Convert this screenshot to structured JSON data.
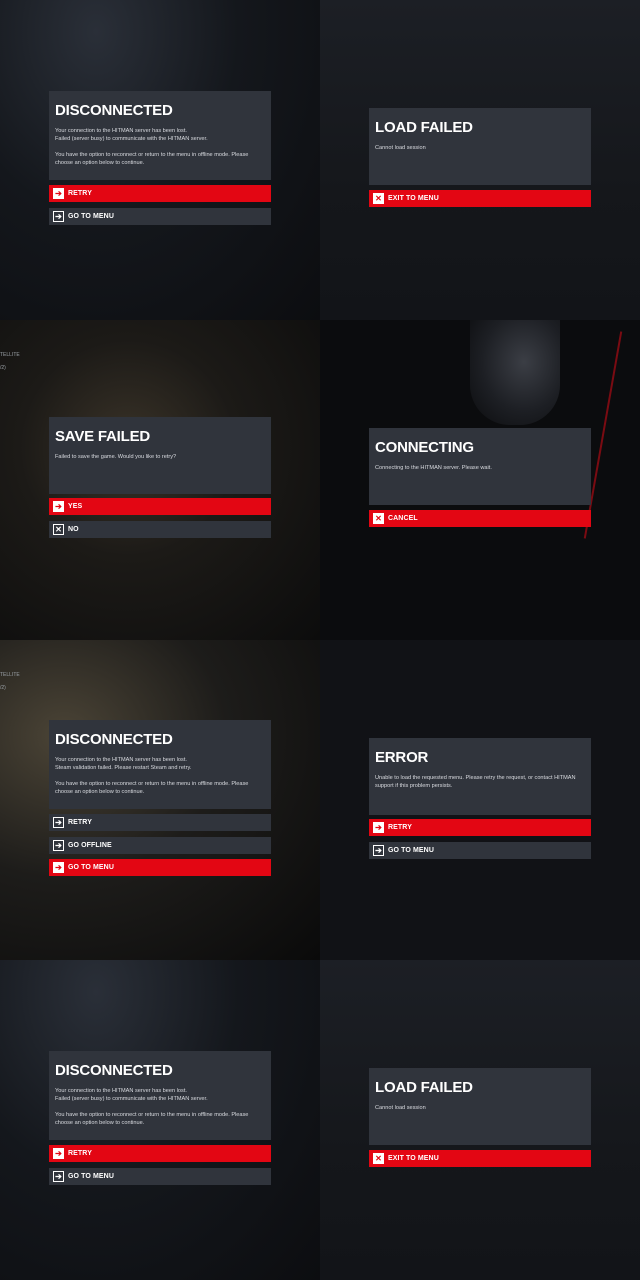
{
  "screens": [
    {
      "title": "DISCONNECTED",
      "body": "Your connection to the HITMAN server has been lost.\nFailed (server busy) to communicate with the HITMAN server.\n\nYou have the option to reconnect or return to the menu in offline mode. Please choose an option below to continue.",
      "buttons": [
        {
          "label": "RETRY",
          "style": "red",
          "icon": "arrow-right-icon"
        },
        {
          "label": "GO TO MENU",
          "style": "dark",
          "icon": "arrow-right-icon"
        }
      ]
    },
    {
      "title": "LOAD FAILED",
      "body": "Cannot load session",
      "buttons": [
        {
          "label": "EXIT TO MENU",
          "style": "red",
          "icon": "close-icon"
        }
      ]
    },
    {
      "title": "SAVE FAILED",
      "body": "Failed to save the game. Would you like to retry?",
      "hud": [
        "TELLITE",
        "/2)"
      ],
      "buttons": [
        {
          "label": "YES",
          "style": "red",
          "icon": "arrow-right-icon"
        },
        {
          "label": "NO",
          "style": "dark",
          "icon": "close-icon"
        }
      ]
    },
    {
      "title": "CONNECTING",
      "body": "Connecting to the HITMAN server. Please wait.",
      "buttons": [
        {
          "label": "CANCEL",
          "style": "red",
          "icon": "close-icon"
        }
      ]
    },
    {
      "title": "DISCONNECTED",
      "body": "Your connection to the HITMAN server has been lost.\nSteam validation failed. Please restart Steam and retry.\n\nYou have the option to reconnect or return to the menu in offline mode. Please choose an option below to continue.",
      "hud": [
        "TELLITE",
        "/2)"
      ],
      "buttons": [
        {
          "label": "RETRY",
          "style": "dark",
          "icon": "arrow-right-icon"
        },
        {
          "label": "GO OFFLINE",
          "style": "dark",
          "icon": "arrow-right-icon"
        },
        {
          "label": "GO TO MENU",
          "style": "red",
          "icon": "arrow-right-icon"
        }
      ]
    },
    {
      "title": "ERROR",
      "body": "Unable to load the requested menu. Please retry the request, or contact HITMAN support if this problem persists.",
      "buttons": [
        {
          "label": "RETRY",
          "style": "red",
          "icon": "arrow-right-icon"
        },
        {
          "label": "GO TO MENU",
          "style": "dark",
          "icon": "arrow-right-icon"
        }
      ]
    },
    {
      "title": "DISCONNECTED",
      "body": "Your connection to the HITMAN server has been lost.\nFailed (server busy) to communicate with the HITMAN server.\n\nYou have the option to reconnect or return to the menu in offline mode. Please choose an option below to continue.",
      "buttons": [
        {
          "label": "RETRY",
          "style": "red",
          "icon": "arrow-right-icon"
        },
        {
          "label": "GO TO MENU",
          "style": "dark",
          "icon": "arrow-right-icon"
        }
      ]
    },
    {
      "title": "LOAD FAILED",
      "body": "Cannot load session",
      "buttons": [
        {
          "label": "EXIT TO MENU",
          "style": "red",
          "icon": "close-icon"
        }
      ]
    }
  ],
  "colors": {
    "accent": "#e30613",
    "panel": "#30343c"
  }
}
